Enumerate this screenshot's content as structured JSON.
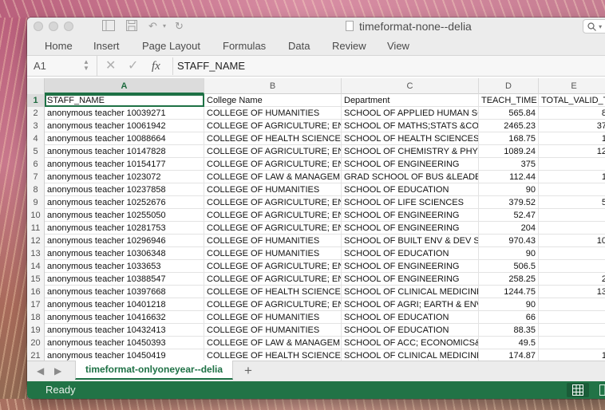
{
  "window": {
    "title": "timeformat-none--delia",
    "search_icon": "magnifier-icon"
  },
  "ribbon": {
    "tabs": [
      "Home",
      "Insert",
      "Page Layout",
      "Formulas",
      "Data",
      "Review",
      "View"
    ]
  },
  "formula_bar": {
    "cell_ref": "A1",
    "fx": "fx",
    "value": "STAFF_NAME"
  },
  "columns": [
    "A",
    "B",
    "C",
    "D",
    "E"
  ],
  "rows": [
    {
      "n": "1",
      "a": "STAFF_NAME",
      "b": "College Name",
      "c": "Department",
      "d": "TEACH_TIME",
      "e": "TOTAL_VALID_TI"
    },
    {
      "n": "2",
      "a": "anonymous teacher 10039271",
      "b": "COLLEGE OF HUMANITIES",
      "c": "SCHOOL OF APPLIED HUMAN SC",
      "d": "565.84",
      "e": "8"
    },
    {
      "n": "3",
      "a": "anonymous teacher 10061942",
      "b": "COLLEGE OF AGRICULTURE; ENGIN",
      "c": "SCHOOL OF MATHS;STATS &COMP",
      "d": "2465.23",
      "e": "37"
    },
    {
      "n": "4",
      "a": "anonymous teacher 10088664",
      "b": "COLLEGE OF HEALTH SCIENCES",
      "c": "SCHOOL OF HEALTH SCIENCES",
      "d": "168.75",
      "e": "1"
    },
    {
      "n": "5",
      "a": "anonymous teacher 10147828",
      "b": "COLLEGE OF AGRICULTURE; ENGIN",
      "c": "SCHOOL OF CHEMISTRY & PHYSICS",
      "d": "1089.24",
      "e": "12"
    },
    {
      "n": "6",
      "a": "anonymous teacher 10154177",
      "b": "COLLEGE OF AGRICULTURE; ENGIN",
      "c": "SCHOOL OF ENGINEERING",
      "d": "375",
      "e": ""
    },
    {
      "n": "7",
      "a": "anonymous teacher 1023072",
      "b": "COLLEGE OF LAW & MANAGEMENT",
      "c": "GRAD SCHOOL OF BUS &LEADERSH",
      "d": "112.44",
      "e": "1"
    },
    {
      "n": "8",
      "a": "anonymous teacher 10237858",
      "b": "COLLEGE OF HUMANITIES",
      "c": "SCHOOL OF EDUCATION",
      "d": "90",
      "e": ""
    },
    {
      "n": "9",
      "a": "anonymous teacher 10252676",
      "b": "COLLEGE OF AGRICULTURE; ENGIN",
      "c": "SCHOOL OF LIFE SCIENCES",
      "d": "379.52",
      "e": "5"
    },
    {
      "n": "10",
      "a": "anonymous teacher 10255050",
      "b": "COLLEGE OF AGRICULTURE; ENGIN",
      "c": "SCHOOL OF ENGINEERING",
      "d": "52.47",
      "e": ""
    },
    {
      "n": "11",
      "a": "anonymous teacher 10281753",
      "b": "COLLEGE OF AGRICULTURE; ENGIN",
      "c": "SCHOOL OF ENGINEERING",
      "d": "204",
      "e": ""
    },
    {
      "n": "12",
      "a": "anonymous teacher 10296946",
      "b": "COLLEGE OF HUMANITIES",
      "c": "SCHOOL OF BUILT ENV & DEV STUD",
      "d": "970.43",
      "e": "10"
    },
    {
      "n": "13",
      "a": "anonymous teacher 10306348",
      "b": "COLLEGE OF HUMANITIES",
      "c": "SCHOOL OF EDUCATION",
      "d": "90",
      "e": ""
    },
    {
      "n": "14",
      "a": "anonymous teacher 1033653",
      "b": "COLLEGE OF AGRICULTURE; ENGIN",
      "c": "SCHOOL OF ENGINEERING",
      "d": "506.5",
      "e": ""
    },
    {
      "n": "15",
      "a": "anonymous teacher 10388547",
      "b": "COLLEGE OF AGRICULTURE; ENGIN",
      "c": "SCHOOL OF ENGINEERING",
      "d": "258.25",
      "e": "2"
    },
    {
      "n": "16",
      "a": "anonymous teacher 10397668",
      "b": "COLLEGE OF HEALTH SCIENCES",
      "c": "SCHOOL OF CLINICAL MEDICINE",
      "d": "1244.75",
      "e": "13"
    },
    {
      "n": "17",
      "a": "anonymous teacher 10401218",
      "b": "COLLEGE OF AGRICULTURE; ENGIN",
      "c": "SCHOOL OF AGRI; EARTH & ENV SC",
      "d": "90",
      "e": ""
    },
    {
      "n": "18",
      "a": "anonymous teacher 10416632",
      "b": "COLLEGE OF HUMANITIES",
      "c": "SCHOOL OF EDUCATION",
      "d": "66",
      "e": ""
    },
    {
      "n": "19",
      "a": "anonymous teacher 10432413",
      "b": "COLLEGE OF HUMANITIES",
      "c": "SCHOOL OF EDUCATION",
      "d": "88.35",
      "e": ""
    },
    {
      "n": "20",
      "a": "anonymous teacher 10450393",
      "b": "COLLEGE OF LAW & MANAGEMENT",
      "c": "SCHOOL OF ACC; ECONOMICS&FIN",
      "d": "49.5",
      "e": ""
    },
    {
      "n": "21",
      "a": "anonymous teacher 10450419",
      "b": "COLLEGE OF HEALTH SCIENCES",
      "c": "SCHOOL OF CLINICAL MEDICINE",
      "d": "174.87",
      "e": "1"
    }
  ],
  "sheet_tabs": {
    "active": "timeformat-onlyoneyear--delia",
    "add_label": "+"
  },
  "status": {
    "text": "Ready"
  },
  "colors": {
    "accent": "#217346",
    "header_bg": "#f3f3f3",
    "selection": "#1e7145"
  }
}
